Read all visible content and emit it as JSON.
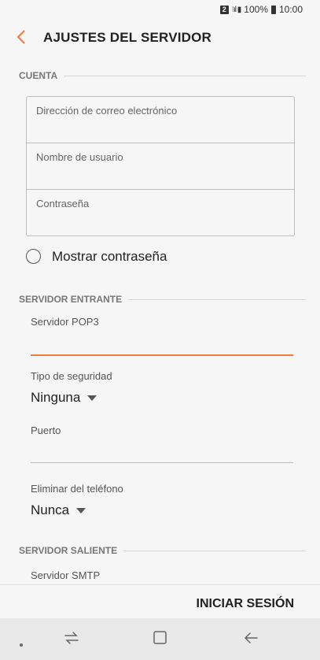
{
  "status": {
    "sim": "2",
    "battery": "100%",
    "time": "10:00"
  },
  "header": {
    "title": "AJUSTES DEL SERVIDOR",
    "back_icon": "chevron-left-icon"
  },
  "account": {
    "section": "CUENTA",
    "email_placeholder": "Dirección de correo electrónico",
    "username_placeholder": "Nombre de usuario",
    "password_placeholder": "Contraseña",
    "show_password_label": "Mostrar contraseña",
    "show_password_checked": false
  },
  "incoming": {
    "section": "SERVIDOR ENTRANTE",
    "server_label": "Servidor POP3",
    "server_value": "",
    "security_label": "Tipo de seguridad",
    "security_value": "Ninguna",
    "port_label": "Puerto",
    "port_value": "",
    "delete_label": "Eliminar del teléfono",
    "delete_value": "Nunca"
  },
  "outgoing": {
    "section": "SERVIDOR SALIENTE",
    "server_label": "Servidor SMTP"
  },
  "footer": {
    "signin": "INICIAR SESIÓN"
  },
  "colors": {
    "accent": "#ee7b44",
    "background": "#f6f6f6",
    "navbar": "#e9e9e9"
  }
}
